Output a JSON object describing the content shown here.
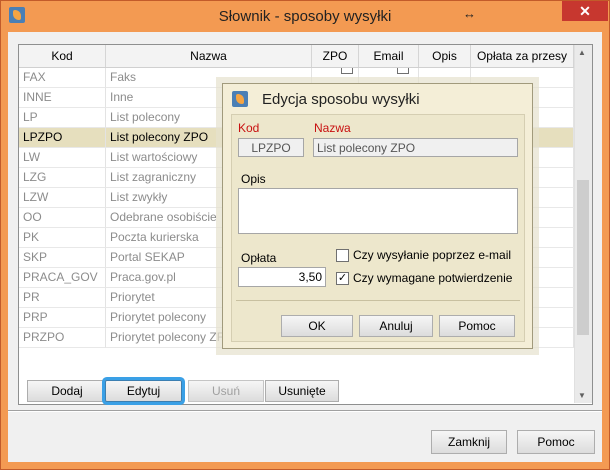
{
  "window": {
    "title": "Słownik - sposoby wysyłki",
    "resize_glyph": "↔",
    "close_glyph": "✕"
  },
  "grid": {
    "columns": [
      "Kod",
      "Nazwa",
      "ZPO",
      "Email",
      "Opis",
      "Opłata za przesy"
    ],
    "rows": [
      {
        "kod": "FAX",
        "nazwa": "Faks",
        "selected": false
      },
      {
        "kod": "INNE",
        "nazwa": "Inne",
        "selected": false
      },
      {
        "kod": "LP",
        "nazwa": "List polecony",
        "selected": false
      },
      {
        "kod": "LPZPO",
        "nazwa": "List polecony ZPO",
        "selected": true
      },
      {
        "kod": "LW",
        "nazwa": "List wartościowy",
        "selected": false
      },
      {
        "kod": "LZG",
        "nazwa": "List zagraniczny",
        "selected": false
      },
      {
        "kod": "LZW",
        "nazwa": "List zwykły",
        "selected": false
      },
      {
        "kod": "OO",
        "nazwa": "Odebrane osobiście",
        "selected": false
      },
      {
        "kod": "PK",
        "nazwa": "Poczta kurierska",
        "selected": false
      },
      {
        "kod": "SKP",
        "nazwa": "Portal SEKAP",
        "selected": false
      },
      {
        "kod": "PRACA_GOV",
        "nazwa": "Praca.gov.pl",
        "selected": false
      },
      {
        "kod": "PR",
        "nazwa": "Priorytet",
        "selected": false
      },
      {
        "kod": "PRP",
        "nazwa": "Priorytet polecony",
        "selected": false
      },
      {
        "kod": "PRZPO",
        "nazwa": "Priorytet polecony ZF",
        "selected": false
      }
    ]
  },
  "toolbar": {
    "add": "Dodaj",
    "edit": "Edytuj",
    "delete": "Usuń",
    "deleted": "Usunięte"
  },
  "footer": {
    "close": "Zamknij",
    "help": "Pomoc"
  },
  "dialog": {
    "title": "Edycja sposobu wysyłki",
    "kod_label": "Kod",
    "kod_value": "LPZPO",
    "nazwa_label": "Nazwa",
    "nazwa_value": "List polecony ZPO",
    "opis_label": "Opis",
    "opis_value": "",
    "oplata_label": "Opłata",
    "oplata_value": "3,50",
    "email_checkbox": "Czy wysyłanie poprzez e-mail",
    "email_checked": false,
    "confirm_checkbox": "Czy wymagane potwierdzenie",
    "confirm_checked": true,
    "ok": "OK",
    "cancel": "Anuluj",
    "help": "Pomoc"
  },
  "colors": {
    "title_bar": "#f39a52",
    "selected_row": "#e6dfbe",
    "required_label": "#c81010",
    "focus_ring": "#3aa0e6"
  }
}
